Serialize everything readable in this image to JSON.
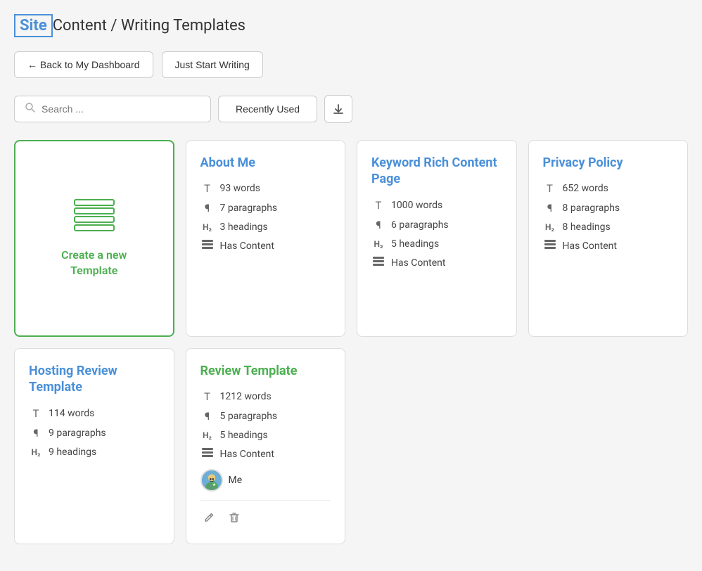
{
  "header": {
    "brand": "Site",
    "title": "Content / Writing Templates"
  },
  "actions": {
    "back_label": "← Back to My Dashboard",
    "write_label": "Just Start Writing"
  },
  "search": {
    "placeholder": "Search ...",
    "recently_used_label": "Recently Used"
  },
  "cards": [
    {
      "id": "create-new",
      "type": "create",
      "label_line1": "Create a new",
      "label_line2": "Template"
    },
    {
      "id": "about-me",
      "type": "template",
      "title": "About Me",
      "title_color": "blue",
      "stats": [
        {
          "icon": "T",
          "text": "93 words"
        },
        {
          "icon": "¶",
          "text": "7 paragraphs"
        },
        {
          "icon": "H2",
          "text": "3 headings"
        },
        {
          "icon": "grid",
          "text": "Has Content"
        }
      ]
    },
    {
      "id": "keyword-rich",
      "type": "template",
      "title": "Keyword Rich Content Page",
      "title_color": "blue",
      "stats": [
        {
          "icon": "T",
          "text": "1000 words"
        },
        {
          "icon": "¶",
          "text": "6 paragraphs"
        },
        {
          "icon": "H2",
          "text": "5 headings"
        },
        {
          "icon": "grid",
          "text": "Has Content"
        }
      ]
    },
    {
      "id": "privacy-policy",
      "type": "template",
      "title": "Privacy Policy",
      "title_color": "blue",
      "stats": [
        {
          "icon": "T",
          "text": "652 words"
        },
        {
          "icon": "¶",
          "text": "8 paragraphs"
        },
        {
          "icon": "H2",
          "text": "8 headings"
        },
        {
          "icon": "grid",
          "text": "Has Content"
        }
      ]
    }
  ],
  "cards_bottom": [
    {
      "id": "hosting-review",
      "type": "template",
      "title": "Hosting Review Template",
      "title_color": "blue",
      "stats": [
        {
          "icon": "T",
          "text": "114 words"
        },
        {
          "icon": "¶",
          "text": "9 paragraphs"
        },
        {
          "icon": "H2",
          "text": "9 headings"
        }
      ]
    },
    {
      "id": "review-template",
      "type": "template",
      "title": "Review Template",
      "title_color": "green",
      "stats": [
        {
          "icon": "T",
          "text": "1212 words"
        },
        {
          "icon": "¶",
          "text": "5 paragraphs"
        },
        {
          "icon": "H2",
          "text": "5 headings"
        },
        {
          "icon": "grid",
          "text": "Has Content"
        }
      ],
      "has_avatar": true,
      "avatar_label": "Me",
      "has_actions": true
    }
  ]
}
